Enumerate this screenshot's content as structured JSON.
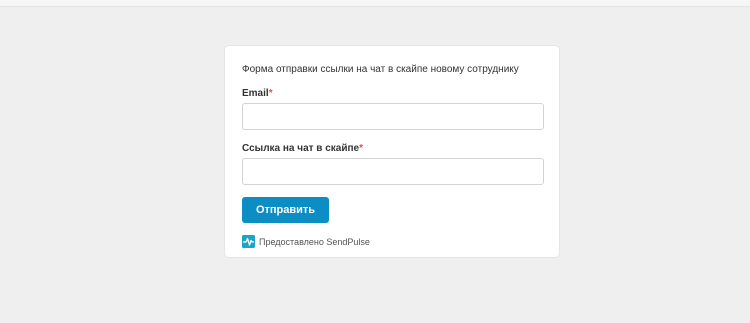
{
  "form": {
    "title": "Форма отправки ссылки на чат в скайпе новому сотруднику",
    "fields": [
      {
        "label": "Email",
        "required_mark": "*",
        "value": "",
        "placeholder": ""
      },
      {
        "label": "Ссылка на чат в скайпе",
        "required_mark": "*",
        "value": "",
        "placeholder": ""
      }
    ],
    "submit_label": "Отправить",
    "powered_by": "Предоставлено SendPulse",
    "powered_icon": "sendpulse-logo-icon"
  },
  "colors": {
    "background": "#efefef",
    "card": "#ffffff",
    "accent": "#0c8dc4",
    "required": "#d9534f",
    "logo": "#1ba3c9"
  }
}
